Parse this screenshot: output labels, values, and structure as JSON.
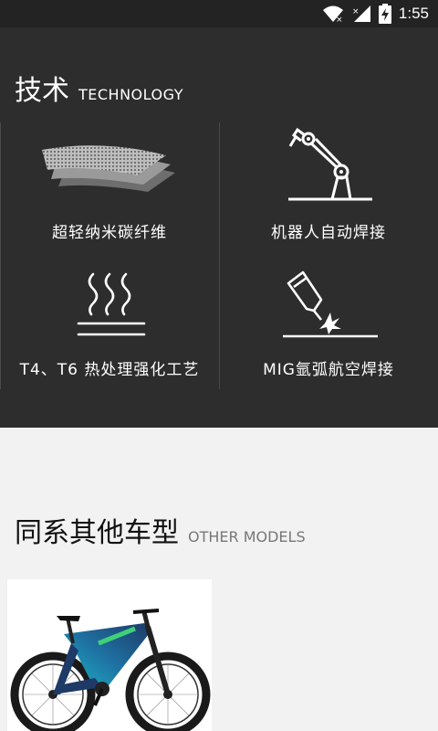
{
  "status_bar": {
    "time": "1:55",
    "icons": [
      "wifi-icon",
      "signal-icon",
      "battery-charging-icon"
    ]
  },
  "technology": {
    "title_zh": "技术",
    "title_en": "TECHNOLOGY",
    "features": [
      {
        "label": "超轻纳米碳纤维",
        "icon": "carbon-fiber-layers-icon"
      },
      {
        "label": "机器人自动焊接",
        "icon": "robot-arm-icon"
      },
      {
        "label": "T4、T6 热处理强化工艺",
        "icon": "heat-treatment-icon"
      },
      {
        "label": "MIG氩弧航空焊接",
        "icon": "welding-torch-icon"
      }
    ]
  },
  "other_models": {
    "title_zh": "同系其他车型",
    "title_en": "OTHER MODELS"
  },
  "colors": {
    "status_bar_bg": "#232323",
    "tech_bg": "#2d2d2d",
    "page_bg": "#f2f2f2",
    "bike_frame_blue": "#1e3a66",
    "bike_frame_cyan": "#1fb5c8",
    "bike_frame_green": "#3fd07a"
  }
}
